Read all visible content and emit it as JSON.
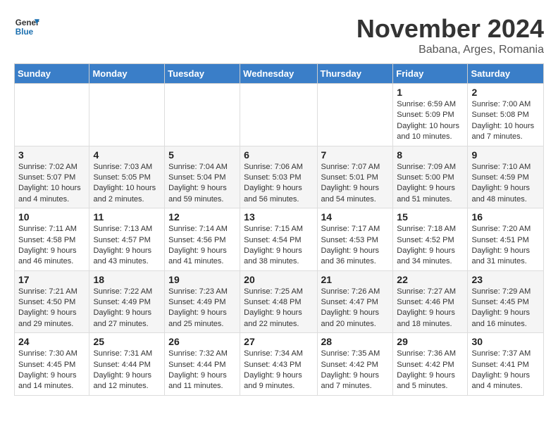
{
  "header": {
    "logo_line1": "General",
    "logo_line2": "Blue",
    "month": "November 2024",
    "location": "Babana, Arges, Romania"
  },
  "days_of_week": [
    "Sunday",
    "Monday",
    "Tuesday",
    "Wednesday",
    "Thursday",
    "Friday",
    "Saturday"
  ],
  "weeks": [
    [
      {
        "day": "",
        "info": ""
      },
      {
        "day": "",
        "info": ""
      },
      {
        "day": "",
        "info": ""
      },
      {
        "day": "",
        "info": ""
      },
      {
        "day": "",
        "info": ""
      },
      {
        "day": "1",
        "info": "Sunrise: 6:59 AM\nSunset: 5:09 PM\nDaylight: 10 hours and 10 minutes."
      },
      {
        "day": "2",
        "info": "Sunrise: 7:00 AM\nSunset: 5:08 PM\nDaylight: 10 hours and 7 minutes."
      }
    ],
    [
      {
        "day": "3",
        "info": "Sunrise: 7:02 AM\nSunset: 5:07 PM\nDaylight: 10 hours and 4 minutes."
      },
      {
        "day": "4",
        "info": "Sunrise: 7:03 AM\nSunset: 5:05 PM\nDaylight: 10 hours and 2 minutes."
      },
      {
        "day": "5",
        "info": "Sunrise: 7:04 AM\nSunset: 5:04 PM\nDaylight: 9 hours and 59 minutes."
      },
      {
        "day": "6",
        "info": "Sunrise: 7:06 AM\nSunset: 5:03 PM\nDaylight: 9 hours and 56 minutes."
      },
      {
        "day": "7",
        "info": "Sunrise: 7:07 AM\nSunset: 5:01 PM\nDaylight: 9 hours and 54 minutes."
      },
      {
        "day": "8",
        "info": "Sunrise: 7:09 AM\nSunset: 5:00 PM\nDaylight: 9 hours and 51 minutes."
      },
      {
        "day": "9",
        "info": "Sunrise: 7:10 AM\nSunset: 4:59 PM\nDaylight: 9 hours and 48 minutes."
      }
    ],
    [
      {
        "day": "10",
        "info": "Sunrise: 7:11 AM\nSunset: 4:58 PM\nDaylight: 9 hours and 46 minutes."
      },
      {
        "day": "11",
        "info": "Sunrise: 7:13 AM\nSunset: 4:57 PM\nDaylight: 9 hours and 43 minutes."
      },
      {
        "day": "12",
        "info": "Sunrise: 7:14 AM\nSunset: 4:56 PM\nDaylight: 9 hours and 41 minutes."
      },
      {
        "day": "13",
        "info": "Sunrise: 7:15 AM\nSunset: 4:54 PM\nDaylight: 9 hours and 38 minutes."
      },
      {
        "day": "14",
        "info": "Sunrise: 7:17 AM\nSunset: 4:53 PM\nDaylight: 9 hours and 36 minutes."
      },
      {
        "day": "15",
        "info": "Sunrise: 7:18 AM\nSunset: 4:52 PM\nDaylight: 9 hours and 34 minutes."
      },
      {
        "day": "16",
        "info": "Sunrise: 7:20 AM\nSunset: 4:51 PM\nDaylight: 9 hours and 31 minutes."
      }
    ],
    [
      {
        "day": "17",
        "info": "Sunrise: 7:21 AM\nSunset: 4:50 PM\nDaylight: 9 hours and 29 minutes."
      },
      {
        "day": "18",
        "info": "Sunrise: 7:22 AM\nSunset: 4:49 PM\nDaylight: 9 hours and 27 minutes."
      },
      {
        "day": "19",
        "info": "Sunrise: 7:23 AM\nSunset: 4:49 PM\nDaylight: 9 hours and 25 minutes."
      },
      {
        "day": "20",
        "info": "Sunrise: 7:25 AM\nSunset: 4:48 PM\nDaylight: 9 hours and 22 minutes."
      },
      {
        "day": "21",
        "info": "Sunrise: 7:26 AM\nSunset: 4:47 PM\nDaylight: 9 hours and 20 minutes."
      },
      {
        "day": "22",
        "info": "Sunrise: 7:27 AM\nSunset: 4:46 PM\nDaylight: 9 hours and 18 minutes."
      },
      {
        "day": "23",
        "info": "Sunrise: 7:29 AM\nSunset: 4:45 PM\nDaylight: 9 hours and 16 minutes."
      }
    ],
    [
      {
        "day": "24",
        "info": "Sunrise: 7:30 AM\nSunset: 4:45 PM\nDaylight: 9 hours and 14 minutes."
      },
      {
        "day": "25",
        "info": "Sunrise: 7:31 AM\nSunset: 4:44 PM\nDaylight: 9 hours and 12 minutes."
      },
      {
        "day": "26",
        "info": "Sunrise: 7:32 AM\nSunset: 4:44 PM\nDaylight: 9 hours and 11 minutes."
      },
      {
        "day": "27",
        "info": "Sunrise: 7:34 AM\nSunset: 4:43 PM\nDaylight: 9 hours and 9 minutes."
      },
      {
        "day": "28",
        "info": "Sunrise: 7:35 AM\nSunset: 4:42 PM\nDaylight: 9 hours and 7 minutes."
      },
      {
        "day": "29",
        "info": "Sunrise: 7:36 AM\nSunset: 4:42 PM\nDaylight: 9 hours and 5 minutes."
      },
      {
        "day": "30",
        "info": "Sunrise: 7:37 AM\nSunset: 4:41 PM\nDaylight: 9 hours and 4 minutes."
      }
    ]
  ]
}
